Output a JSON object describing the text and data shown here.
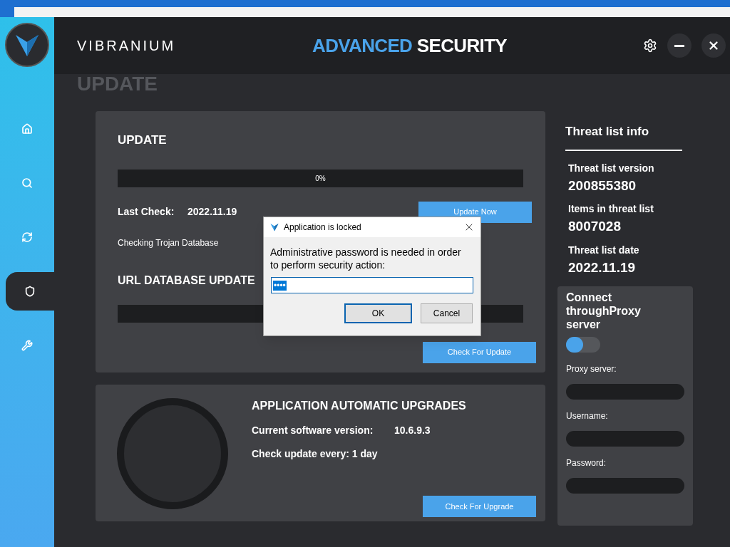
{
  "app": {
    "brand": "VIBRANIUM",
    "title_accent": "ADVANCED",
    "title": "SECURITY",
    "page_title": "UPDATE"
  },
  "sidebar": {
    "items": [
      {
        "kind": "home",
        "selected": false
      },
      {
        "kind": "search",
        "selected": false
      },
      {
        "kind": "sync",
        "selected": false
      },
      {
        "kind": "shield",
        "selected": true
      },
      {
        "kind": "tools",
        "selected": false
      }
    ]
  },
  "update": {
    "heading": "UPDATE",
    "progress": {
      "level": 0,
      "reading": "0%"
    },
    "last_check_label": "Last Check:",
    "last_check_value": "2022.11.19",
    "update_button": "Update Now",
    "status": "Checking Trojan Database",
    "url_heading": "URL DATABASE UPDATE",
    "url_progress": {
      "level": 0
    },
    "check_button": "Check For Update"
  },
  "upgrades": {
    "heading": "APPLICATION AUTOMATIC UPGRADES",
    "version_label": "Current software version:",
    "version_value": "10.6.9.3",
    "interval": "Check update every: 1 day",
    "button": "Check For Upgrade"
  },
  "threat_info": {
    "heading": "Threat list info",
    "items": [
      {
        "label": "Threat list version",
        "value": "200855380"
      },
      {
        "label": "Items in threat list",
        "value": "8007028"
      },
      {
        "label": "Threat list date",
        "value": "2022.11.19"
      }
    ]
  },
  "proxy": {
    "heading": "Connect throughProxy server",
    "toggle": {
      "on": false
    },
    "fields": [
      {
        "label": "Proxy server:"
      },
      {
        "label": "Username:"
      },
      {
        "label": "Password:"
      }
    ]
  },
  "dialog": {
    "title": "Application is locked",
    "message": "Administrative password is needed in order to perform security action:",
    "password_value": "••••",
    "buttons": [
      {
        "label": "OK",
        "default": true
      },
      {
        "label": "Cancel",
        "default": false
      }
    ]
  }
}
